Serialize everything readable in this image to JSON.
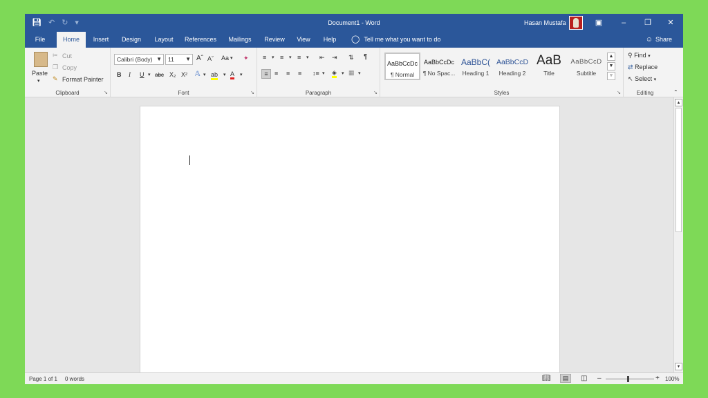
{
  "titlebar": {
    "document_title": "Document1 - Word",
    "user_name": "Hasan Mustafa",
    "qat": {
      "save_icon": "floppy-icon",
      "undo_icon": "undo-icon",
      "redo_icon": "redo-icon",
      "customize_icon": "chevron-down-icon"
    },
    "controls": {
      "ribbon_display": "ribbon-display-icon",
      "minimize": "minimize-icon",
      "restore": "restore-icon",
      "close": "close-icon"
    }
  },
  "tabs": [
    "File",
    "Home",
    "Insert",
    "Design",
    "Layout",
    "References",
    "Mailings",
    "Review",
    "View",
    "Help"
  ],
  "active_tab": "Home",
  "tell_me": "Tell me what you want to do",
  "share": "Share",
  "ribbon": {
    "clipboard": {
      "label": "Clipboard",
      "paste": "Paste",
      "cut": "Cut",
      "copy": "Copy",
      "format_painter": "Format Painter"
    },
    "font": {
      "label": "Font",
      "font_name": "Calibri (Body)",
      "font_size": "11",
      "change_case": "Aa",
      "bold": "B",
      "italic": "I",
      "underline": "U",
      "strike": "abc",
      "subscript": "X₂",
      "superscript": "X²",
      "text_color": "A"
    },
    "paragraph": {
      "label": "Paragraph",
      "pilcrow": "¶"
    },
    "styles": {
      "label": "Styles",
      "items": [
        {
          "sample": "AaBbCcDc",
          "name": "¶ Normal"
        },
        {
          "sample": "AaBbCcDc",
          "name": "¶ No Spac..."
        },
        {
          "sample": "AaBbC(",
          "name": "Heading 1"
        },
        {
          "sample": "AaBbCcD",
          "name": "Heading 2"
        },
        {
          "sample": "AaB",
          "name": "Title"
        },
        {
          "sample": "AaBbCcD",
          "name": "Subtitle"
        }
      ]
    },
    "editing": {
      "label": "Editing",
      "find": "Find",
      "replace": "Replace",
      "select": "Select"
    }
  },
  "status": {
    "page": "Page 1 of 1",
    "words": "0 words",
    "zoom": "100%"
  },
  "colors": {
    "word_blue": "#2b579a",
    "background_green": "#7ed957"
  }
}
